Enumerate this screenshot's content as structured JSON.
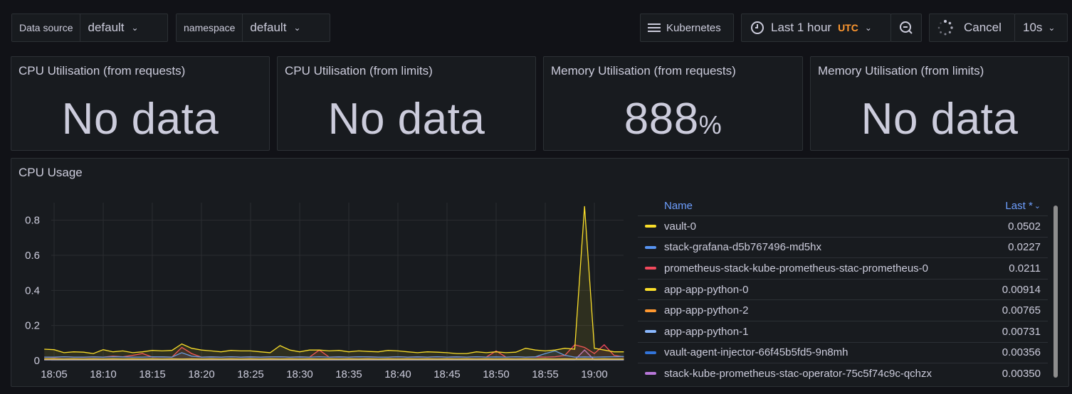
{
  "toolbar": {
    "datasource_label": "Data source",
    "datasource_value": "default",
    "namespace_label": "namespace",
    "namespace_value": "default",
    "dashboard_button": "Kubernetes",
    "time_range": "Last 1 hour",
    "timezone": "UTC",
    "cancel_label": "Cancel",
    "refresh_interval": "10s"
  },
  "stats": [
    {
      "title": "CPU Utilisation (from requests)",
      "value": "No data",
      "unit": ""
    },
    {
      "title": "CPU Utilisation (from limits)",
      "value": "No data",
      "unit": ""
    },
    {
      "title": "Memory Utilisation (from requests)",
      "value": "888",
      "unit": "%"
    },
    {
      "title": "Memory Utilisation (from limits)",
      "value": "No data",
      "unit": ""
    }
  ],
  "cpu_panel": {
    "title": "CPU Usage",
    "legend_header_name": "Name",
    "legend_header_last": "Last *",
    "legend": [
      {
        "name": "vault-0",
        "last": "0.0502",
        "color": "#fade2a"
      },
      {
        "name": "stack-grafana-d5b767496-md5hx",
        "last": "0.0227",
        "color": "#5794f2"
      },
      {
        "name": "prometheus-stack-kube-prometheus-stac-prometheus-0",
        "last": "0.0211",
        "color": "#f2495c"
      },
      {
        "name": "app-app-python-0",
        "last": "0.00914",
        "color": "#fade2a"
      },
      {
        "name": "app-app-python-2",
        "last": "0.00765",
        "color": "#ff9830"
      },
      {
        "name": "app-app-python-1",
        "last": "0.00731",
        "color": "#8ab8ff"
      },
      {
        "name": "vault-agent-injector-66f45b5fd5-9n8mh",
        "last": "0.00356",
        "color": "#3274d9"
      },
      {
        "name": "stack-kube-prometheus-stac-operator-75c5f74c9c-qchzx",
        "last": "0.00350",
        "color": "#b877d9"
      }
    ]
  },
  "chart_data": {
    "type": "line",
    "title": "CPU Usage",
    "xlabel": "",
    "ylabel": "",
    "ylim": [
      0,
      0.9
    ],
    "y_ticks": [
      "0",
      "0.2",
      "0.4",
      "0.6",
      "0.8"
    ],
    "x_ticks": [
      "18:05",
      "18:10",
      "18:15",
      "18:20",
      "18:25",
      "18:30",
      "18:35",
      "18:40",
      "18:45",
      "18:50",
      "18:55",
      "19:00"
    ],
    "x_range_minutes": [
      0,
      59
    ],
    "grid": true,
    "series": [
      {
        "name": "vault-0",
        "color": "#fade2a",
        "values": [
          0.065,
          0.062,
          0.045,
          0.05,
          0.048,
          0.04,
          0.062,
          0.05,
          0.055,
          0.045,
          0.05,
          0.058,
          0.055,
          0.058,
          0.095,
          0.07,
          0.06,
          0.055,
          0.05,
          0.058,
          0.055,
          0.055,
          0.05,
          0.045,
          0.085,
          0.06,
          0.05,
          0.06,
          0.06,
          0.055,
          0.058,
          0.05,
          0.055,
          0.052,
          0.05,
          0.058,
          0.055,
          0.05,
          0.045,
          0.05,
          0.048,
          0.045,
          0.04,
          0.04,
          0.05,
          0.045,
          0.05,
          0.045,
          0.048,
          0.07,
          0.06,
          0.055,
          0.06,
          0.07,
          0.065,
          0.88,
          0.07,
          0.06,
          0.05,
          0.05
        ]
      },
      {
        "name": "stack-grafana-d5b767496-md5hx",
        "color": "#5794f2",
        "values": [
          0.02,
          0.02,
          0.022,
          0.02,
          0.02,
          0.021,
          0.02,
          0.022,
          0.021,
          0.02,
          0.02,
          0.022,
          0.021,
          0.02,
          0.045,
          0.025,
          0.02,
          0.021,
          0.02,
          0.022,
          0.02,
          0.021,
          0.02,
          0.021,
          0.022,
          0.02,
          0.021,
          0.02,
          0.022,
          0.02,
          0.021,
          0.02,
          0.022,
          0.021,
          0.02,
          0.02,
          0.022,
          0.02,
          0.021,
          0.02,
          0.022,
          0.02,
          0.021,
          0.02,
          0.022,
          0.02,
          0.021,
          0.02,
          0.022,
          0.02,
          0.021,
          0.04,
          0.055,
          0.03,
          0.02,
          0.021,
          0.02,
          0.021,
          0.022,
          0.023
        ]
      },
      {
        "name": "prometheus-stack-kube-prometheus-stac-prometheus-0",
        "color": "#f2495c",
        "values": [
          0.02,
          0.018,
          0.022,
          0.02,
          0.019,
          0.021,
          0.02,
          0.025,
          0.022,
          0.03,
          0.04,
          0.02,
          0.021,
          0.02,
          0.075,
          0.04,
          0.02,
          0.021,
          0.02,
          0.022,
          0.02,
          0.021,
          0.02,
          0.021,
          0.022,
          0.02,
          0.021,
          0.02,
          0.06,
          0.02,
          0.021,
          0.02,
          0.022,
          0.021,
          0.02,
          0.02,
          0.022,
          0.02,
          0.021,
          0.02,
          0.022,
          0.02,
          0.021,
          0.02,
          0.022,
          0.02,
          0.055,
          0.02,
          0.022,
          0.02,
          0.021,
          0.02,
          0.022,
          0.03,
          0.09,
          0.075,
          0.04,
          0.09,
          0.03,
          0.021
        ]
      },
      {
        "name": "app-app-python-0",
        "color": "#fade2a",
        "values": [
          0.01,
          0.01,
          0.009,
          0.01,
          0.009,
          0.01,
          0.009,
          0.01,
          0.009,
          0.01,
          0.009,
          0.01,
          0.009,
          0.01,
          0.009,
          0.01,
          0.009,
          0.01,
          0.009,
          0.01,
          0.009,
          0.01,
          0.009,
          0.01,
          0.009,
          0.01,
          0.009,
          0.01,
          0.009,
          0.01,
          0.009,
          0.01,
          0.009,
          0.01,
          0.009,
          0.01,
          0.009,
          0.01,
          0.009,
          0.01,
          0.009,
          0.01,
          0.009,
          0.01,
          0.009,
          0.01,
          0.009,
          0.01,
          0.009,
          0.01,
          0.009,
          0.01,
          0.009,
          0.01,
          0.009,
          0.01,
          0.009,
          0.01,
          0.009,
          0.009
        ]
      },
      {
        "name": "app-app-python-2",
        "color": "#ff9830",
        "values": [
          0.008,
          0.008,
          0.008,
          0.008,
          0.008,
          0.008,
          0.008,
          0.008,
          0.008,
          0.008,
          0.008,
          0.008,
          0.008,
          0.008,
          0.008,
          0.008,
          0.008,
          0.008,
          0.008,
          0.008,
          0.008,
          0.008,
          0.008,
          0.008,
          0.008,
          0.008,
          0.008,
          0.008,
          0.008,
          0.008,
          0.008,
          0.008,
          0.008,
          0.008,
          0.008,
          0.008,
          0.008,
          0.008,
          0.008,
          0.008,
          0.008,
          0.008,
          0.008,
          0.008,
          0.008,
          0.008,
          0.008,
          0.008,
          0.008,
          0.008,
          0.008,
          0.008,
          0.008,
          0.008,
          0.008,
          0.008,
          0.008,
          0.008,
          0.008,
          0.008
        ]
      },
      {
        "name": "app-app-python-1",
        "color": "#8ab8ff",
        "values": [
          0.007,
          0.007,
          0.007,
          0.007,
          0.007,
          0.007,
          0.007,
          0.007,
          0.007,
          0.007,
          0.007,
          0.007,
          0.007,
          0.007,
          0.007,
          0.007,
          0.007,
          0.007,
          0.007,
          0.007,
          0.007,
          0.007,
          0.007,
          0.007,
          0.007,
          0.007,
          0.007,
          0.007,
          0.007,
          0.007,
          0.007,
          0.007,
          0.007,
          0.007,
          0.007,
          0.007,
          0.007,
          0.007,
          0.007,
          0.007,
          0.007,
          0.007,
          0.007,
          0.007,
          0.007,
          0.007,
          0.007,
          0.007,
          0.007,
          0.007,
          0.007,
          0.007,
          0.007,
          0.007,
          0.007,
          0.007,
          0.007,
          0.007,
          0.007,
          0.007
        ]
      },
      {
        "name": "vault-agent-injector-66f45b5fd5-9n8mh",
        "color": "#3274d9",
        "values": [
          0.004,
          0.004,
          0.004,
          0.004,
          0.004,
          0.004,
          0.004,
          0.004,
          0.004,
          0.004,
          0.004,
          0.004,
          0.004,
          0.004,
          0.004,
          0.004,
          0.004,
          0.004,
          0.004,
          0.004,
          0.004,
          0.004,
          0.004,
          0.004,
          0.004,
          0.004,
          0.004,
          0.004,
          0.004,
          0.004,
          0.004,
          0.004,
          0.004,
          0.004,
          0.004,
          0.004,
          0.004,
          0.004,
          0.004,
          0.004,
          0.004,
          0.004,
          0.004,
          0.004,
          0.004,
          0.004,
          0.004,
          0.004,
          0.004,
          0.004,
          0.004,
          0.004,
          0.004,
          0.004,
          0.004,
          0.004,
          0.004,
          0.004,
          0.004,
          0.004
        ]
      },
      {
        "name": "stack-kube-prometheus-stac-operator-75c5f74c9c-qchzx",
        "color": "#b877d9",
        "values": [
          0.0035,
          0.0035,
          0.0035,
          0.0035,
          0.0035,
          0.0035,
          0.0035,
          0.0035,
          0.0035,
          0.0035,
          0.0035,
          0.0035,
          0.0035,
          0.0035,
          0.0035,
          0.0035,
          0.0035,
          0.0035,
          0.0035,
          0.0035,
          0.0035,
          0.0035,
          0.0035,
          0.0035,
          0.0035,
          0.0035,
          0.0035,
          0.0035,
          0.0035,
          0.0035,
          0.0035,
          0.0035,
          0.0035,
          0.0035,
          0.0035,
          0.0035,
          0.0035,
          0.0035,
          0.0035,
          0.0035,
          0.0035,
          0.0035,
          0.0035,
          0.0035,
          0.0035,
          0.0035,
          0.0035,
          0.0035,
          0.0035,
          0.0035,
          0.0035,
          0.0035,
          0.0035,
          0.0035,
          0.0035,
          0.06,
          0.0035,
          0.0035,
          0.0035,
          0.0035
        ]
      }
    ]
  }
}
